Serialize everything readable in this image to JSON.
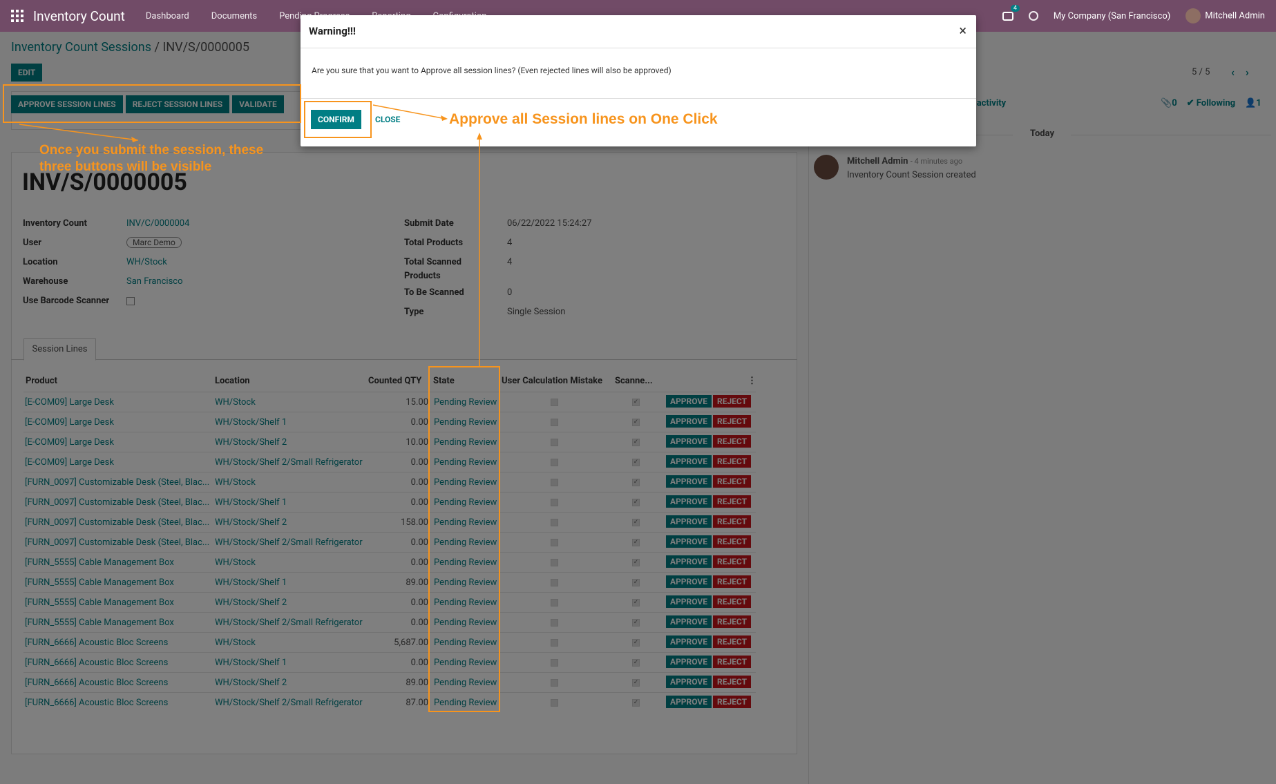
{
  "topbar": {
    "app_title": "Inventory Count",
    "menu": [
      "Dashboard",
      "Documents",
      "Pending Progress",
      "Reporting",
      "Configuration"
    ],
    "chat_count": "4",
    "company": "My Company (San Francisco)",
    "user": "Mitchell Admin"
  },
  "breadcrumb": {
    "parent": "Inventory Count Sessions",
    "separator": " / ",
    "current": "INV/S/0000005"
  },
  "edit_label": "EDIT",
  "pager": {
    "text": "5 / 5",
    "prev": "‹",
    "next": "›"
  },
  "actions": {
    "approve": "APPROVE SESSION LINES",
    "reject": "REJECT SESSION LINES",
    "validate": "VALIDATE"
  },
  "record": {
    "name": "INV/S/0000005",
    "left_fields": [
      {
        "label": "Inventory Count",
        "value": "INV/C/0000004"
      },
      {
        "label": "User",
        "value": "Marc Demo"
      },
      {
        "label": "Location",
        "value": "WH/Stock"
      },
      {
        "label": "Warehouse",
        "value": "San Francisco"
      },
      {
        "label": "Use Barcode Scanner",
        "value": ""
      }
    ],
    "right_fields": [
      {
        "label": "Submit Date",
        "value": "06/22/2022 15:24:27"
      },
      {
        "label": "Total Products",
        "value": "4"
      },
      {
        "label": "Total Scanned",
        "label2": "Products",
        "value": "4"
      },
      {
        "label": "To Be Scanned",
        "value": "0"
      },
      {
        "label": "Type",
        "value": "Single Session"
      }
    ]
  },
  "tab": "Session Lines",
  "table": {
    "headers": [
      "Product",
      "Location",
      "Counted QTY",
      "State",
      "User Calculation Mistake",
      "Scanne..."
    ],
    "approve_label": "APPROVE",
    "reject_label": "REJECT",
    "rows": [
      {
        "product": "[E-COM09] Large Desk",
        "location": "WH/Stock",
        "qty": "15.00",
        "state": "Pending Review"
      },
      {
        "product": "[E-COM09] Large Desk",
        "location": "WH/Stock/Shelf 1",
        "qty": "0.00",
        "state": "Pending Review"
      },
      {
        "product": "[E-COM09] Large Desk",
        "location": "WH/Stock/Shelf 2",
        "qty": "10.00",
        "state": "Pending Review"
      },
      {
        "product": "[E-COM09] Large Desk",
        "location": "WH/Stock/Shelf 2/Small Refrigerator",
        "qty": "0.00",
        "state": "Pending Review"
      },
      {
        "product": "[FURN_0097] Customizable Desk (Steel, Blac...",
        "location": "WH/Stock",
        "qty": "0.00",
        "state": "Pending Review"
      },
      {
        "product": "[FURN_0097] Customizable Desk (Steel, Blac...",
        "location": "WH/Stock/Shelf 1",
        "qty": "0.00",
        "state": "Pending Review"
      },
      {
        "product": "[FURN_0097] Customizable Desk (Steel, Blac...",
        "location": "WH/Stock/Shelf 2",
        "qty": "158.00",
        "state": "Pending Review"
      },
      {
        "product": "[FURN_0097] Customizable Desk (Steel, Blac...",
        "location": "WH/Stock/Shelf 2/Small Refrigerator",
        "qty": "0.00",
        "state": "Pending Review"
      },
      {
        "product": "[FURN_5555] Cable Management Box",
        "location": "WH/Stock",
        "qty": "0.00",
        "state": "Pending Review"
      },
      {
        "product": "[FURN_5555] Cable Management Box",
        "location": "WH/Stock/Shelf 1",
        "qty": "89.00",
        "state": "Pending Review"
      },
      {
        "product": "[FURN_5555] Cable Management Box",
        "location": "WH/Stock/Shelf 2",
        "qty": "0.00",
        "state": "Pending Review"
      },
      {
        "product": "[FURN_5555] Cable Management Box",
        "location": "WH/Stock/Shelf 2/Small Refrigerator",
        "qty": "0.00",
        "state": "Pending Review"
      },
      {
        "product": "[FURN_6666] Acoustic Bloc Screens",
        "location": "WH/Stock",
        "qty": "5,687.00",
        "state": "Pending Review"
      },
      {
        "product": "[FURN_6666] Acoustic Bloc Screens",
        "location": "WH/Stock/Shelf 1",
        "qty": "0.00",
        "state": "Pending Review"
      },
      {
        "product": "[FURN_6666] Acoustic Bloc Screens",
        "location": "WH/Stock/Shelf 2",
        "qty": "89.00",
        "state": "Pending Review"
      },
      {
        "product": "[FURN_6666] Acoustic Bloc Screens",
        "location": "WH/Stock/Shelf 2/Small Refrigerator",
        "qty": "87.00",
        "state": "Pending Review"
      }
    ]
  },
  "chatter": {
    "schedule_activity": "le activity",
    "attachments": "0",
    "following": "Following",
    "followers": "1",
    "today": "Today",
    "message": {
      "author": "Mitchell Admin",
      "time": "- 4 minutes ago",
      "body": "Inventory Count Session created"
    }
  },
  "dialog": {
    "title": "Warning!!!",
    "close_x": "×",
    "body": "Are you sure that you want to Approve all session lines? (Even rejected lines will also be approved)",
    "confirm": "CONFIRM",
    "close": "CLOSE"
  },
  "annotations": {
    "left_line1": "Once you submit the session,  these",
    "left_line2": "three buttons will be visible",
    "right": "Approve all Session lines on One Click"
  },
  "colors": {
    "brand": "#714b67",
    "accent": "#017e84",
    "danger": "#c8141a",
    "annotation": "#f7941d"
  }
}
